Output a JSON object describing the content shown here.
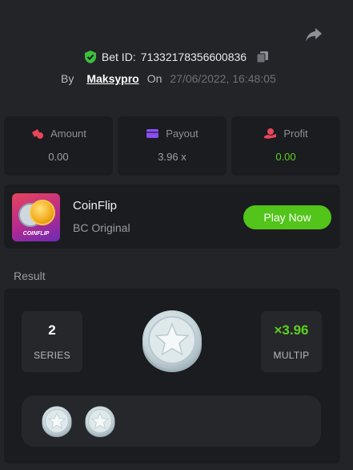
{
  "header": {
    "bet_id_label": "Bet ID:",
    "bet_id": "71332178356600836",
    "by_label": "By",
    "username": "Maksypro",
    "on_label": "On",
    "datetime": "27/06/2022, 16:48:05"
  },
  "stats": [
    {
      "label": "Amount",
      "value": "0.00",
      "icon": "coins-icon",
      "color": "#e8455b"
    },
    {
      "label": "Payout",
      "value": "3.96 x",
      "icon": "card-icon",
      "color": "#8a4ff0"
    },
    {
      "label": "Profit",
      "value": "0.00",
      "icon": "hand-coin-icon",
      "color": "#e8455b"
    }
  ],
  "game": {
    "name": "CoinFlip",
    "subtitle": "BC Original",
    "thumb_label": "COINFLIP",
    "play_label": "Play Now"
  },
  "result": {
    "label": "Result",
    "series_value": "2",
    "series_label": "SERIES",
    "multiplier_value": "×3.96",
    "multiplier_label": "MULTIP",
    "coin_face": "silver-star",
    "history": [
      "silver-star",
      "silver-star"
    ]
  },
  "colors": {
    "accent_green": "#52c41a",
    "profit_green": "#5bd11e",
    "background": "#232427",
    "panel": "#1b1c1f"
  }
}
